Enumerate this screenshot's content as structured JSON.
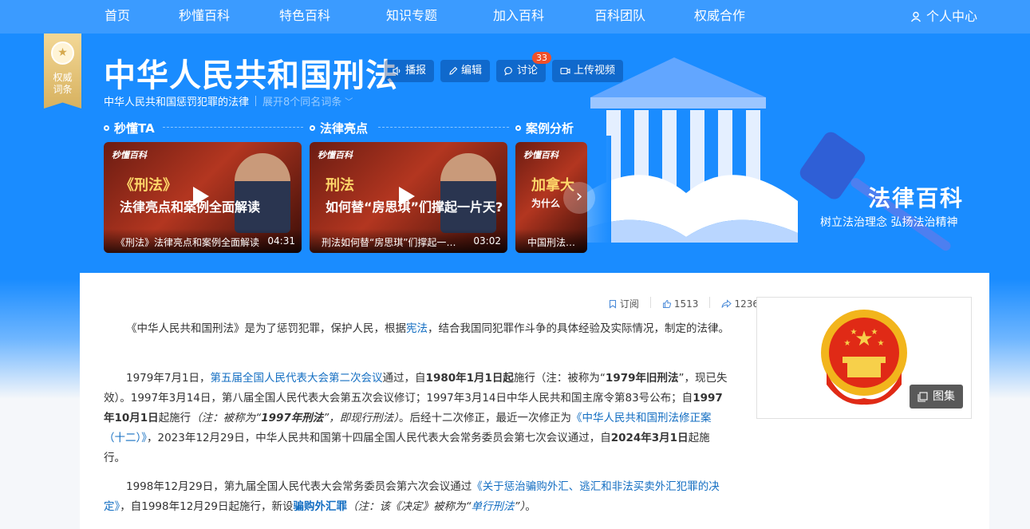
{
  "nav": {
    "items": [
      "首页",
      "秒懂百科",
      "特色百科",
      "知识专题",
      "加入百科",
      "百科团队",
      "权威合作"
    ],
    "user": "个人中心"
  },
  "badge": {
    "line1": "权威",
    "line2": "词条"
  },
  "entry": {
    "title": "中华人民共和国刑法",
    "subtitle": "中华人民共和国惩罚犯罪的法律",
    "expand": "展开8个同名词条",
    "tools": {
      "broadcast": "播报",
      "edit": "编辑",
      "discuss": "讨论",
      "discuss_count": "33",
      "upload": "上传视频"
    }
  },
  "sections": [
    "秒懂TA",
    "法律亮点",
    "案例分析"
  ],
  "videos": [
    {
      "logo": "秒懂百科",
      "line1": "《刑法》",
      "line2": "法律亮点和案例全面解读",
      "caption": "《刑法》法律亮点和案例全面解读",
      "duration": "04:31"
    },
    {
      "logo": "秒懂百科",
      "line1": "刑法",
      "line2": "如何替“房思琪”们撑起一片天?",
      "caption": "刑法如何替“房思琪”们撑起一片天?",
      "duration": "03:02"
    },
    {
      "logo": "秒懂百科",
      "line1": "加拿大",
      "line2": "为什么",
      "caption": "中国刑法为什么",
      "duration": ""
    }
  ],
  "banner": {
    "title": "法律百科",
    "slogan": "树立法治理念 弘扬法治精神"
  },
  "stats": {
    "subscribe": "订阅",
    "likes": "1513",
    "shares": "1236"
  },
  "gallery": "图集",
  "paragraphs": {
    "p1": {
      "a": "《中华人民共和国刑法》是为了惩罚犯罪，保护人民，根据",
      "link": "宪法",
      "b": "，结合我国同犯罪作斗争的具体经验及实际情况，制定的法律。"
    },
    "p2": {
      "t1": "1979年7月1日，",
      "l1": "第五届全国人民代表大会第二次会议",
      "t2": "通过，自",
      "b1": "1980年1月1日起",
      "t3": "施行（注：被称为“",
      "b2": "1979年旧刑法",
      "t4": "”，现已失效）。1997年3月14日，第八届全国人民代表大会第五次会议修订；1997年3月14日中华人民共和国主席令第83号公布；自",
      "b3": "1997年10月1日",
      "t5": "起施行",
      "i1": "（注：被称为“",
      "ib": "1997年刑法",
      "i2": "”，即现行刑法）",
      "t6": "。后经十二次修正，最近一次修正为",
      "l2": "《中华人民共和国刑法修正案（十二）》",
      "t7": "，2023年12月29日，中华人民共和国第十四届全国人民代表大会常务委员会第七次会议通过，自",
      "b4": "2024年3月1日",
      "t8": "起施行。"
    },
    "p3": {
      "t1": "1998年12月29日，第九届全国人民代表大会常务委员会第六次会议通过",
      "l1": "《关于惩治骗购外汇、逃汇和非法买卖外汇犯罪的决定》",
      "t2": "，自1998年12月29日起施行，新设",
      "l2": "骗购外汇罪",
      "i1": "（注：该《决定》被称为“",
      "l3": "单行刑法",
      "i2": "”）",
      "t3": "。"
    }
  },
  "colors": {
    "hero": "#1a8cff",
    "nav": "#3b9bff",
    "link": "#136ec2",
    "badge_red": "#f0502a"
  }
}
